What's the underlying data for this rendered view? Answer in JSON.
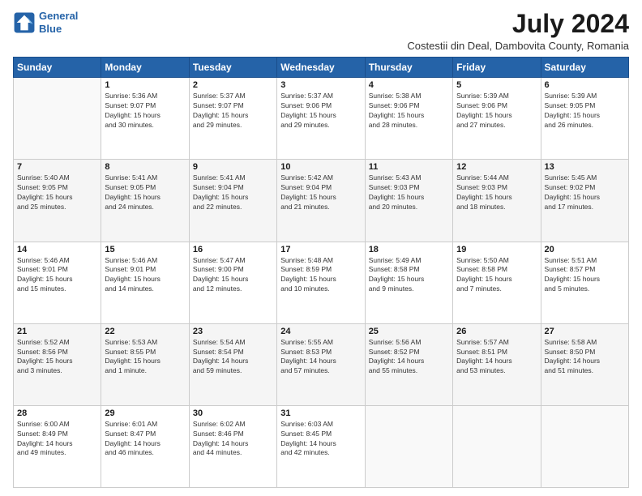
{
  "header": {
    "logo_line1": "General",
    "logo_line2": "Blue",
    "month_year": "July 2024",
    "location": "Costestii din Deal, Dambovita County, Romania"
  },
  "days_of_week": [
    "Sunday",
    "Monday",
    "Tuesday",
    "Wednesday",
    "Thursday",
    "Friday",
    "Saturday"
  ],
  "weeks": [
    [
      {
        "num": "",
        "info": ""
      },
      {
        "num": "1",
        "info": "Sunrise: 5:36 AM\nSunset: 9:07 PM\nDaylight: 15 hours\nand 30 minutes."
      },
      {
        "num": "2",
        "info": "Sunrise: 5:37 AM\nSunset: 9:07 PM\nDaylight: 15 hours\nand 29 minutes."
      },
      {
        "num": "3",
        "info": "Sunrise: 5:37 AM\nSunset: 9:06 PM\nDaylight: 15 hours\nand 29 minutes."
      },
      {
        "num": "4",
        "info": "Sunrise: 5:38 AM\nSunset: 9:06 PM\nDaylight: 15 hours\nand 28 minutes."
      },
      {
        "num": "5",
        "info": "Sunrise: 5:39 AM\nSunset: 9:06 PM\nDaylight: 15 hours\nand 27 minutes."
      },
      {
        "num": "6",
        "info": "Sunrise: 5:39 AM\nSunset: 9:05 PM\nDaylight: 15 hours\nand 26 minutes."
      }
    ],
    [
      {
        "num": "7",
        "info": "Sunrise: 5:40 AM\nSunset: 9:05 PM\nDaylight: 15 hours\nand 25 minutes."
      },
      {
        "num": "8",
        "info": "Sunrise: 5:41 AM\nSunset: 9:05 PM\nDaylight: 15 hours\nand 24 minutes."
      },
      {
        "num": "9",
        "info": "Sunrise: 5:41 AM\nSunset: 9:04 PM\nDaylight: 15 hours\nand 22 minutes."
      },
      {
        "num": "10",
        "info": "Sunrise: 5:42 AM\nSunset: 9:04 PM\nDaylight: 15 hours\nand 21 minutes."
      },
      {
        "num": "11",
        "info": "Sunrise: 5:43 AM\nSunset: 9:03 PM\nDaylight: 15 hours\nand 20 minutes."
      },
      {
        "num": "12",
        "info": "Sunrise: 5:44 AM\nSunset: 9:03 PM\nDaylight: 15 hours\nand 18 minutes."
      },
      {
        "num": "13",
        "info": "Sunrise: 5:45 AM\nSunset: 9:02 PM\nDaylight: 15 hours\nand 17 minutes."
      }
    ],
    [
      {
        "num": "14",
        "info": "Sunrise: 5:46 AM\nSunset: 9:01 PM\nDaylight: 15 hours\nand 15 minutes."
      },
      {
        "num": "15",
        "info": "Sunrise: 5:46 AM\nSunset: 9:01 PM\nDaylight: 15 hours\nand 14 minutes."
      },
      {
        "num": "16",
        "info": "Sunrise: 5:47 AM\nSunset: 9:00 PM\nDaylight: 15 hours\nand 12 minutes."
      },
      {
        "num": "17",
        "info": "Sunrise: 5:48 AM\nSunset: 8:59 PM\nDaylight: 15 hours\nand 10 minutes."
      },
      {
        "num": "18",
        "info": "Sunrise: 5:49 AM\nSunset: 8:58 PM\nDaylight: 15 hours\nand 9 minutes."
      },
      {
        "num": "19",
        "info": "Sunrise: 5:50 AM\nSunset: 8:58 PM\nDaylight: 15 hours\nand 7 minutes."
      },
      {
        "num": "20",
        "info": "Sunrise: 5:51 AM\nSunset: 8:57 PM\nDaylight: 15 hours\nand 5 minutes."
      }
    ],
    [
      {
        "num": "21",
        "info": "Sunrise: 5:52 AM\nSunset: 8:56 PM\nDaylight: 15 hours\nand 3 minutes."
      },
      {
        "num": "22",
        "info": "Sunrise: 5:53 AM\nSunset: 8:55 PM\nDaylight: 15 hours\nand 1 minute."
      },
      {
        "num": "23",
        "info": "Sunrise: 5:54 AM\nSunset: 8:54 PM\nDaylight: 14 hours\nand 59 minutes."
      },
      {
        "num": "24",
        "info": "Sunrise: 5:55 AM\nSunset: 8:53 PM\nDaylight: 14 hours\nand 57 minutes."
      },
      {
        "num": "25",
        "info": "Sunrise: 5:56 AM\nSunset: 8:52 PM\nDaylight: 14 hours\nand 55 minutes."
      },
      {
        "num": "26",
        "info": "Sunrise: 5:57 AM\nSunset: 8:51 PM\nDaylight: 14 hours\nand 53 minutes."
      },
      {
        "num": "27",
        "info": "Sunrise: 5:58 AM\nSunset: 8:50 PM\nDaylight: 14 hours\nand 51 minutes."
      }
    ],
    [
      {
        "num": "28",
        "info": "Sunrise: 6:00 AM\nSunset: 8:49 PM\nDaylight: 14 hours\nand 49 minutes."
      },
      {
        "num": "29",
        "info": "Sunrise: 6:01 AM\nSunset: 8:47 PM\nDaylight: 14 hours\nand 46 minutes."
      },
      {
        "num": "30",
        "info": "Sunrise: 6:02 AM\nSunset: 8:46 PM\nDaylight: 14 hours\nand 44 minutes."
      },
      {
        "num": "31",
        "info": "Sunrise: 6:03 AM\nSunset: 8:45 PM\nDaylight: 14 hours\nand 42 minutes."
      },
      {
        "num": "",
        "info": ""
      },
      {
        "num": "",
        "info": ""
      },
      {
        "num": "",
        "info": ""
      }
    ]
  ]
}
